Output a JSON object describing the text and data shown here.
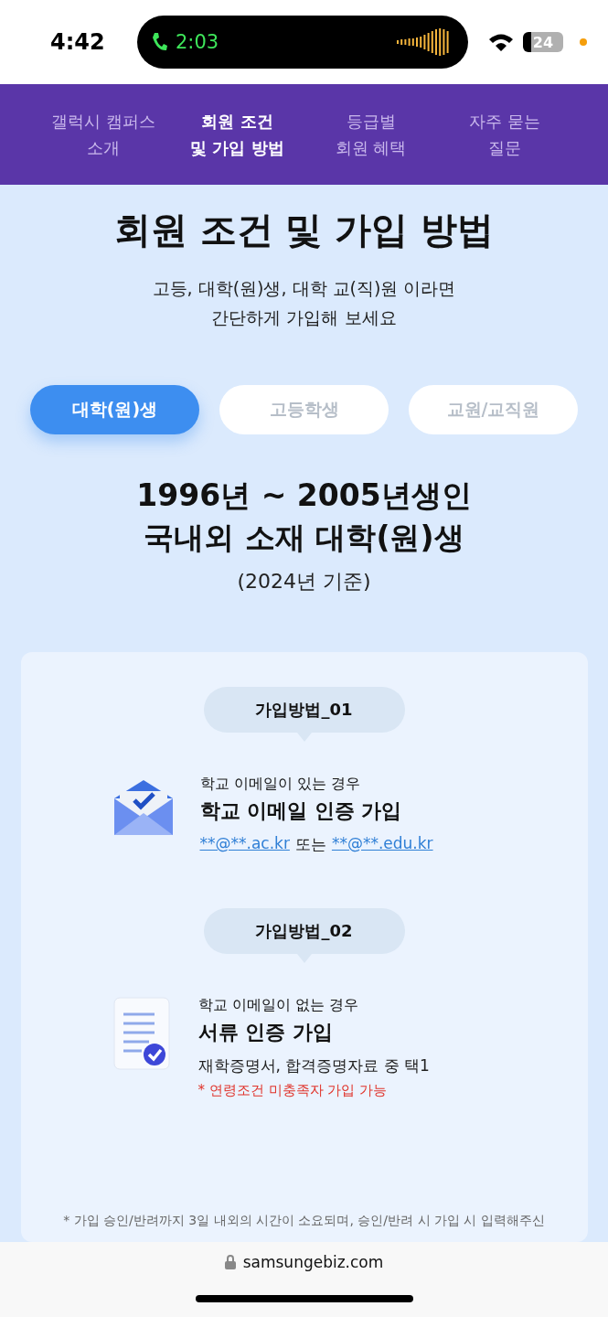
{
  "status_bar": {
    "time": "4:42",
    "call_time": "2:03",
    "battery": "24"
  },
  "nav_tabs": [
    {
      "label": "갤럭시 캠퍼스\n소개",
      "selected": false
    },
    {
      "label": "회원 조건\n및 가입 방법",
      "selected": true
    },
    {
      "label": "등급별\n회원 혜택",
      "selected": false
    },
    {
      "label": "자주 묻는\n질문",
      "selected": false
    }
  ],
  "title": "회원 조건 및 가입 방법",
  "subtitle": "고등, 대학(원)생, 대학 교(직)원 이라면\n간단하게 가입해 보세요",
  "segments": [
    {
      "label": "대학(원)생",
      "selected": true
    },
    {
      "label": "고등학생",
      "selected": false
    },
    {
      "label": "교원/교직원",
      "selected": false
    }
  ],
  "eligibility": {
    "lines": [
      "1996년 ~ 2005년생인",
      "국내외 소재 대학(원)생"
    ],
    "note": "(2024년 기준)"
  },
  "methods": [
    {
      "kind": "email",
      "badge": "가입방법_01",
      "condition": "학교 이메일이 있는 경우",
      "title": "학교 이메일 인증 가입",
      "links": [
        "**@**.ac.kr",
        "**@**.edu.kr"
      ],
      "connector": "또는"
    },
    {
      "kind": "document",
      "badge": "가입방법_02",
      "condition": "학교 이메일이 없는 경우",
      "title": "서류 인증 가입",
      "detail": "재학증명서, 합격증명자료 중 택1",
      "warning": "* 연령조건 미충족자 가입 가능"
    }
  ],
  "footnote": "* 가입 승인/반려까지 3일 내외의 시간이 소요되며, 승인/반려 시 가입 시 입력해주신",
  "address_bar": {
    "url": "samsungebiz.com"
  }
}
